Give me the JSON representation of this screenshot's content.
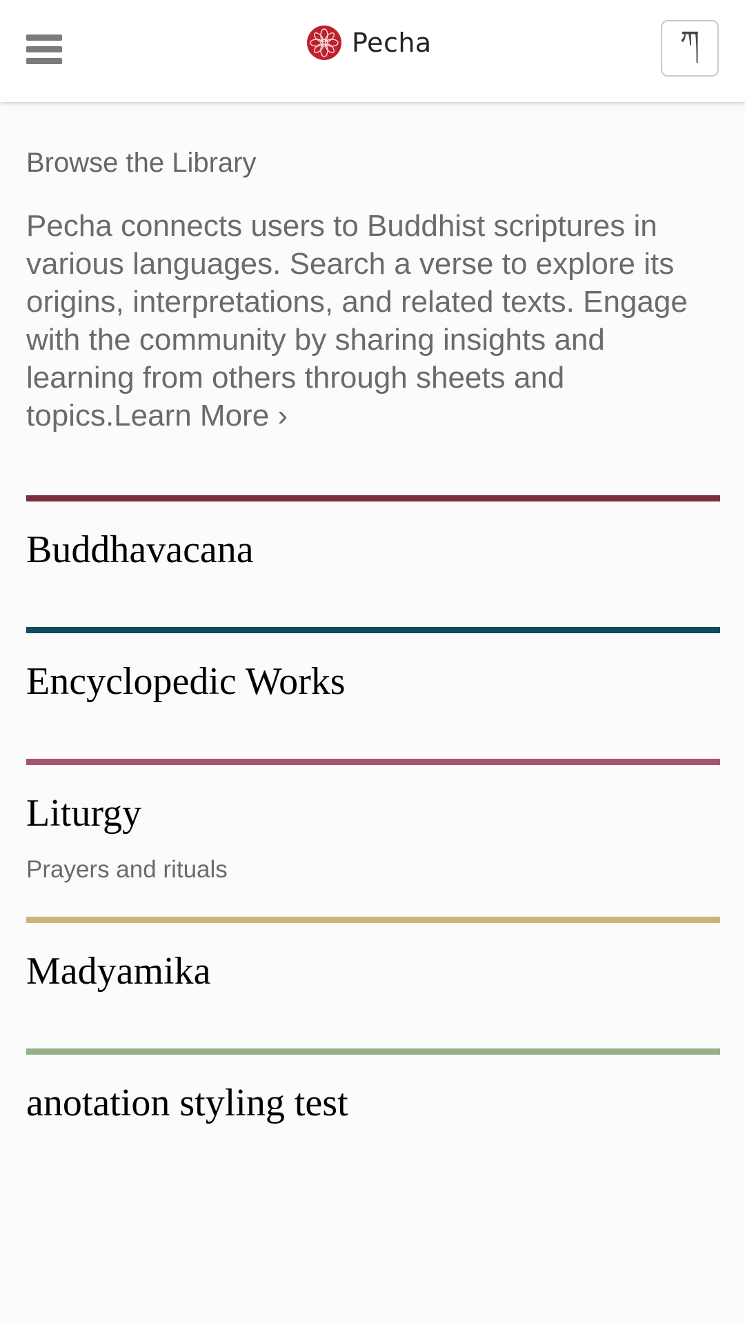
{
  "header": {
    "app_name": "Pecha",
    "language_toggle": "ཀ",
    "icons": {
      "menu": "hamburger-menu-icon",
      "logo": "pecha-flower-logo"
    },
    "logo_color": "#c0202e"
  },
  "intro": {
    "title": "Browse the Library",
    "description": "Pecha connects users to Buddhist scriptures in various languages. Search a verse to explore its origins, interpretations, and related texts. Engage with the community by sharing insights and learning from others through sheets and topics.",
    "learn_more": "Learn More ›"
  },
  "categories": [
    {
      "title": "Buddhavacana",
      "subtitle": "",
      "color": "#7c2d40"
    },
    {
      "title": "Encyclopedic Works",
      "subtitle": "",
      "color": "#0f4c5c"
    },
    {
      "title": "Liturgy",
      "subtitle": "Prayers and rituals",
      "color": "#a5556e"
    },
    {
      "title": "Madyamika",
      "subtitle": "",
      "color": "#cdb27c"
    },
    {
      "title": "anotation styling test",
      "subtitle": "",
      "color": "#96b08a"
    }
  ]
}
